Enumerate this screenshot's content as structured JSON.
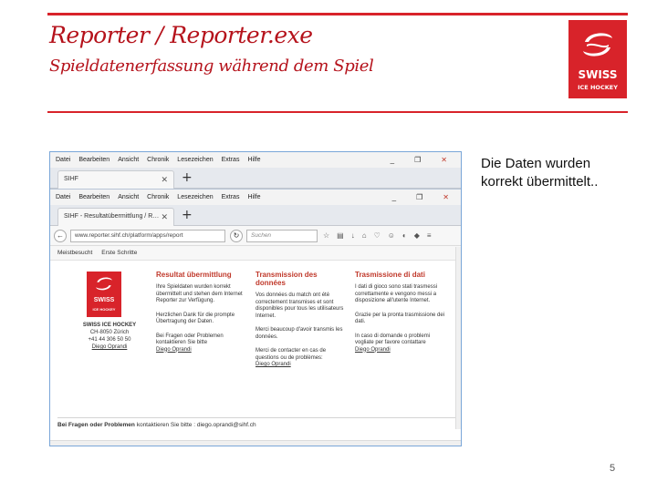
{
  "slide": {
    "title": "Reporter / Reporter.exe",
    "subtitle": "Spieldatenerfassung während dem Spiel",
    "note_line1": "Die Daten wurden",
    "note_line2": "korrekt übermittelt..",
    "page_number": "5",
    "accent_color": "#d8232a"
  },
  "logo": {
    "line1": "SWISS",
    "line2": "ICE HOCKEY"
  },
  "browser": {
    "menu": [
      "Datei",
      "Bearbeiten",
      "Ansicht",
      "Chronik",
      "Lesezeichen",
      "Extras",
      "Hilfe"
    ],
    "window_controls": [
      "_",
      "❐",
      "✕"
    ],
    "tab1_label": "SIHF",
    "tab2_label": "SIHF - Resultatübermittlung / R…",
    "tab_close": "✕",
    "new_tab": "+",
    "url": "www.reporter.sihf.ch/platform/apps/report",
    "search_placeholder": "Suchen",
    "bookmarks": [
      "Meistbesucht",
      "Erste Schritte"
    ],
    "mini_logo": {
      "line1": "SWISS",
      "line2": "ICE HOCKEY"
    },
    "address": {
      "org": "SWISS ICE HOCKEY",
      "city": "CH-8050 Zürich",
      "phone": "+41 44 306 50 50",
      "contact": "Diego Oprandi"
    },
    "columns": [
      {
        "heading": "Resultat übermittlung",
        "p1": "Ihre Spieldaten wurden korrekt übermittelt und stehen dem Internet Reporter zur Verfügung.",
        "p2": "Herzlichen Dank für die prompte Übertragung der Daten.",
        "p3": "Bei Fragen oder Problemen kontaktieren Sie bitte",
        "link": "Diego Oprandi"
      },
      {
        "heading": "Transmission des données",
        "p1": "Vos données du match ont été correctement transmises et sont disponibles pour tous les utilisateurs Internet.",
        "p2": "Merci beaucoup d'avoir transmis les données.",
        "p3": "Merci de contacter en cas de questions ou de problèmes:",
        "link": "Diego Oprandi"
      },
      {
        "heading": "Trasmissione di dati",
        "p1": "I dati di gioco sono stati trasmessi correttamente e vengono messi a disposizione all'utente Internet.",
        "p2": "Grazie per la pronta trasmissione dei dati.",
        "p3": "In caso di domande o problemi vogliate per favore contattare",
        "link": "Diego Oprandi"
      }
    ],
    "footer_bold": "Bei Fragen oder Problemen",
    "footer_rest": "kontaktieren Sie bitte : diego.oprandi@sihf.ch"
  }
}
